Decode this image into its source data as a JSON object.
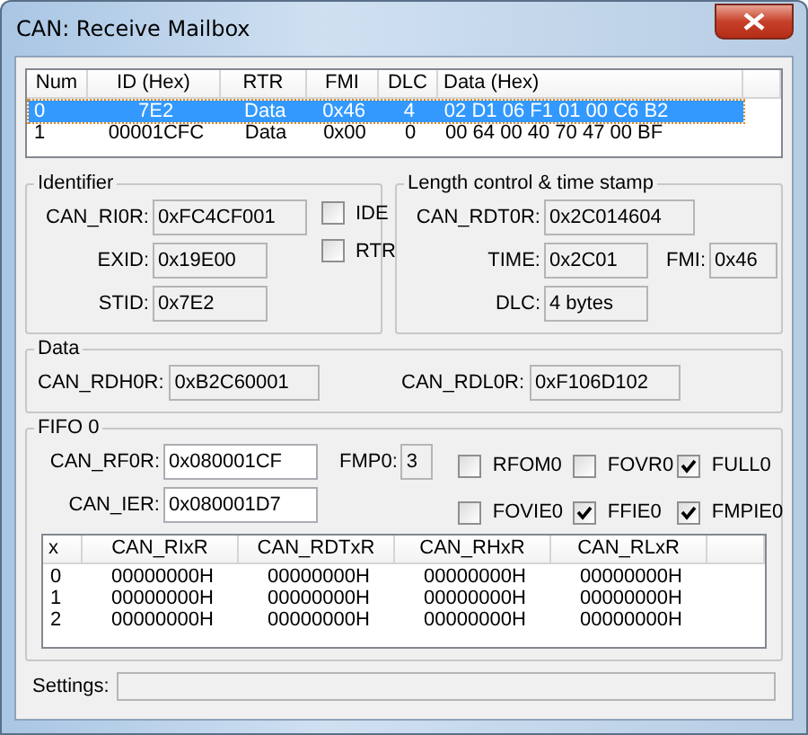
{
  "window": {
    "title": "CAN: Receive Mailbox"
  },
  "mailbox_table": {
    "columns": [
      "Num",
      "ID (Hex)",
      "RTR",
      "FMI",
      "DLC",
      "Data (Hex)"
    ],
    "rows": [
      {
        "cells": [
          "0",
          "7E2",
          "Data",
          "0x46",
          "4",
          "02 D1 06 F1 01 00 C6 B2"
        ],
        "selected": true
      },
      {
        "cells": [
          "1",
          "00001CFC",
          "Data",
          "0x00",
          "0",
          "00 64 00 40 70 47 00 BF"
        ],
        "selected": false
      }
    ]
  },
  "identifier": {
    "title": "Identifier",
    "fields": [
      {
        "label": "CAN_RI0R:",
        "value": "0xFC4CF001",
        "readonly": true
      },
      {
        "label": "EXID:",
        "value": "0x19E00",
        "readonly": true
      },
      {
        "label": "STID:",
        "value": "0x7E2",
        "readonly": true
      }
    ],
    "checkboxes": [
      {
        "label": "IDE",
        "checked": false
      },
      {
        "label": "RTR",
        "checked": false
      }
    ]
  },
  "length_control": {
    "title": "Length control & time stamp",
    "rows": [
      [
        {
          "label": "CAN_RDT0R:",
          "value": "0x2C014604",
          "readonly": true
        }
      ],
      [
        {
          "label": "TIME:",
          "value": "0x2C01",
          "readonly": true
        },
        {
          "label": "FMI:",
          "value": "0x46",
          "readonly": true
        }
      ],
      [
        {
          "label": "DLC:",
          "value": "4 bytes",
          "readonly": true
        }
      ]
    ]
  },
  "data": {
    "title": "Data",
    "fields": [
      {
        "label": "CAN_RDH0R:",
        "value": "0xB2C60001",
        "readonly": true
      },
      {
        "label": "CAN_RDL0R:",
        "value": "0xF106D102",
        "readonly": true
      }
    ]
  },
  "fifo": {
    "title": "FIFO 0",
    "fields": [
      {
        "label": "CAN_RF0R:",
        "value": "0x080001CF",
        "readonly": false
      },
      {
        "label": "FMP0:",
        "value": "3",
        "readonly": true
      },
      {
        "label": "CAN_IER:",
        "value": "0x080001D7",
        "readonly": false
      }
    ],
    "checkboxes": [
      {
        "label": "RFOM0",
        "checked": false
      },
      {
        "label": "FOVR0",
        "checked": false
      },
      {
        "label": "FULL0",
        "checked": true
      },
      {
        "label": "FOVIE0",
        "checked": false
      },
      {
        "label": "FFIE0",
        "checked": true
      },
      {
        "label": "FMPIE0",
        "checked": true
      }
    ],
    "register_table": {
      "columns": [
        "x",
        "CAN_RIxR",
        "CAN_RDTxR",
        "CAN_RHxR",
        "CAN_RLxR"
      ],
      "rows": [
        [
          "0",
          "00000000H",
          "00000000H",
          "00000000H",
          "00000000H"
        ],
        [
          "1",
          "00000000H",
          "00000000H",
          "00000000H",
          "00000000H"
        ],
        [
          "2",
          "00000000H",
          "00000000H",
          "00000000H",
          "00000000H"
        ]
      ]
    }
  },
  "settings": {
    "label": "Settings:"
  }
}
